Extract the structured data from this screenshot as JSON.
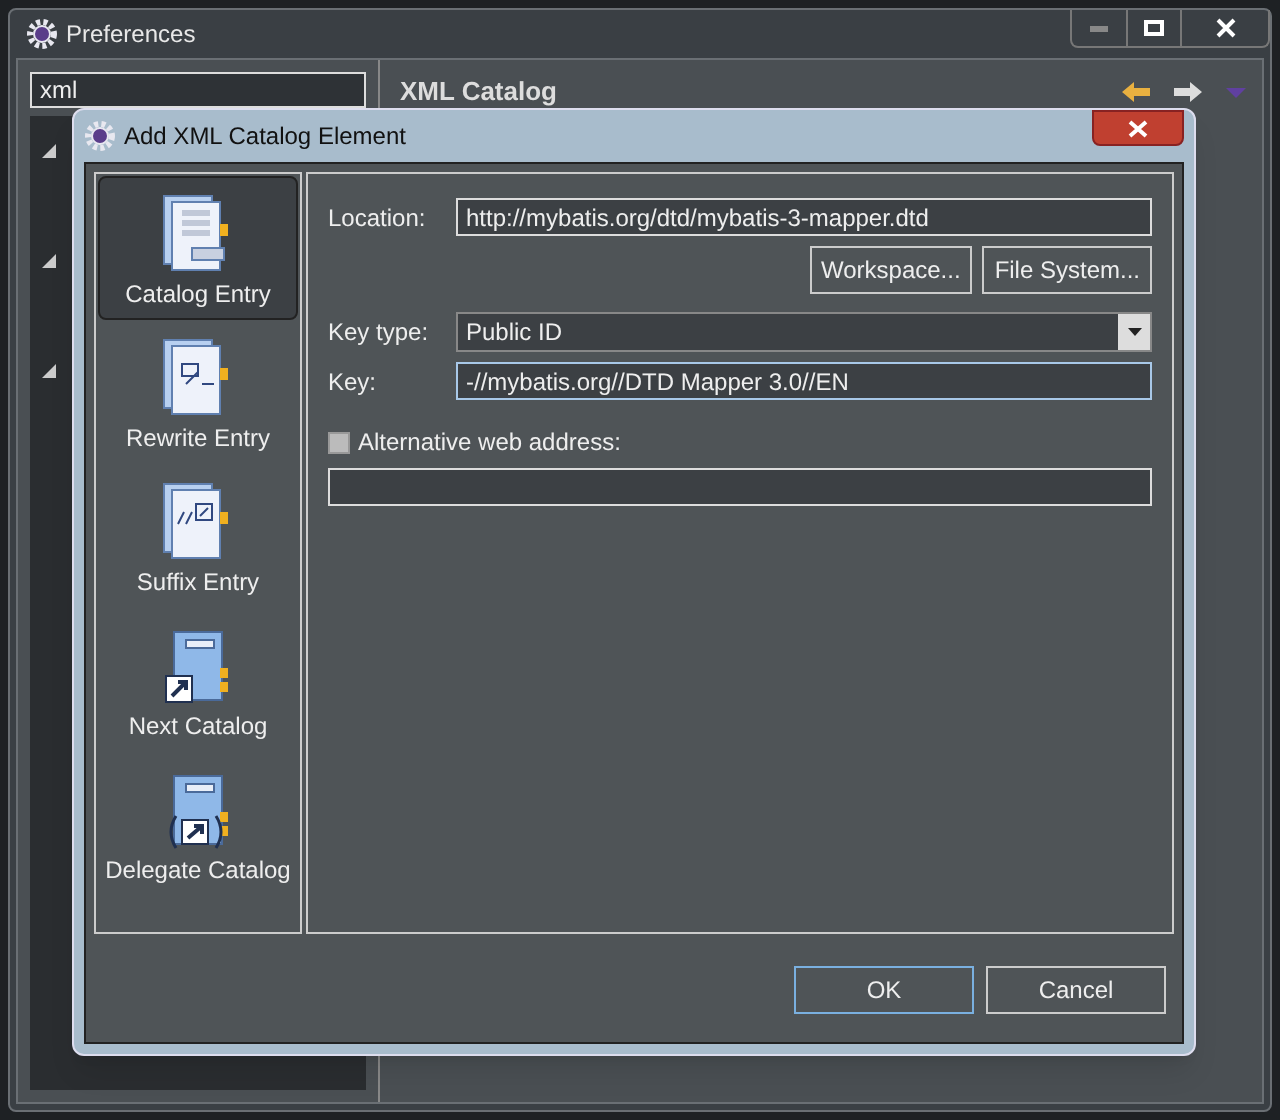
{
  "window": {
    "title": "Preferences"
  },
  "filter": {
    "value": "xml"
  },
  "page": {
    "title": "XML Catalog"
  },
  "dialog": {
    "title": "Add XML Catalog Element",
    "entry_types": [
      {
        "label": "Catalog Entry",
        "kind": "catalog-entry",
        "selected": true
      },
      {
        "label": "Rewrite Entry",
        "kind": "rewrite-entry",
        "selected": false
      },
      {
        "label": "Suffix Entry",
        "kind": "suffix-entry",
        "selected": false
      },
      {
        "label": "Next Catalog",
        "kind": "next-catalog",
        "selected": false
      },
      {
        "label": "Delegate Catalog",
        "kind": "delegate-catalog",
        "selected": false
      }
    ],
    "location": {
      "label": "Location:",
      "value": "http://mybatis.org/dtd/mybatis-3-mapper.dtd"
    },
    "browse_buttons": [
      "Workspace...",
      "File System..."
    ],
    "key_type": {
      "label": "Key type:",
      "value": "Public ID"
    },
    "key": {
      "label": "Key:",
      "value": "-//mybatis.org//DTD Mapper 3.0//EN"
    },
    "alternative": {
      "label": "Alternative web address:",
      "checked": false
    },
    "buttons": [
      {
        "label": "OK",
        "default": true
      },
      {
        "label": "Cancel",
        "default": false
      }
    ]
  }
}
